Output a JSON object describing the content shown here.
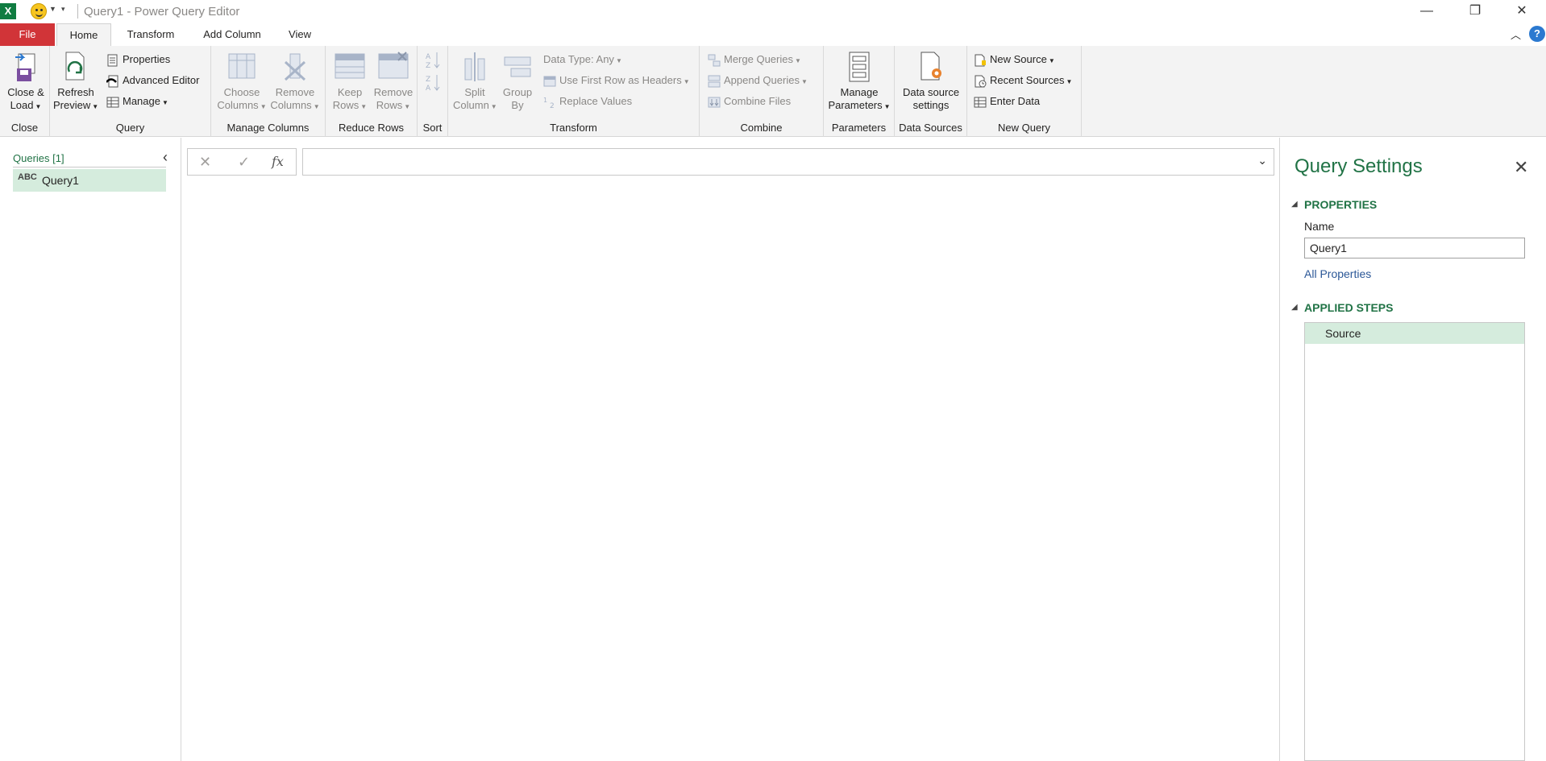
{
  "window": {
    "title": "Query1 - Power Query Editor",
    "app_logo": "X"
  },
  "tabs": {
    "file": "File",
    "home": "Home",
    "transform": "Transform",
    "add_column": "Add Column",
    "view": "View"
  },
  "ribbon": {
    "close": {
      "close_load_1": "Close &",
      "close_load_2": "Load",
      "label": "Close"
    },
    "query": {
      "refresh_1": "Refresh",
      "refresh_2": "Preview",
      "properties": "Properties",
      "advanced_editor": "Advanced Editor",
      "manage": "Manage",
      "label": "Query"
    },
    "manage_columns": {
      "choose_1": "Choose",
      "choose_2": "Columns",
      "remove_1": "Remove",
      "remove_2": "Columns",
      "label": "Manage Columns"
    },
    "reduce_rows": {
      "keep_1": "Keep",
      "keep_2": "Rows",
      "remove_1": "Remove",
      "remove_2": "Rows",
      "label": "Reduce Rows"
    },
    "sort": {
      "label": "Sort"
    },
    "transform": {
      "split_1": "Split",
      "split_2": "Column",
      "group_1": "Group",
      "group_2": "By",
      "data_type": "Data Type: Any",
      "first_row": "Use First Row as Headers",
      "replace": "Replace Values",
      "label": "Transform"
    },
    "combine": {
      "merge": "Merge Queries",
      "append": "Append Queries",
      "combine_files": "Combine Files",
      "label": "Combine"
    },
    "parameters": {
      "manage_1": "Manage",
      "manage_2": "Parameters",
      "label": "Parameters"
    },
    "data_sources": {
      "ds_1": "Data source",
      "ds_2": "settings",
      "label": "Data Sources"
    },
    "new_query": {
      "new_source": "New Source",
      "recent_sources": "Recent Sources",
      "enter_data": "Enter Data",
      "label": "New Query"
    }
  },
  "queries_pane": {
    "title": "Queries [1]",
    "items": [
      {
        "type_glyph": "ABC",
        "name": "Query1"
      }
    ]
  },
  "formula_bar": {
    "fx": "fx",
    "value": ""
  },
  "query_settings": {
    "title": "Query Settings",
    "properties_heading": "PROPERTIES",
    "name_label": "Name",
    "name_value": "Query1",
    "all_properties": "All Properties",
    "applied_steps_heading": "APPLIED STEPS",
    "steps": [
      "Source"
    ]
  },
  "colors": {
    "accent_green": "#217346",
    "file_red": "#d13438",
    "selected_bg": "#d5ecdd",
    "ribbon_bg": "#f3f3f3"
  }
}
